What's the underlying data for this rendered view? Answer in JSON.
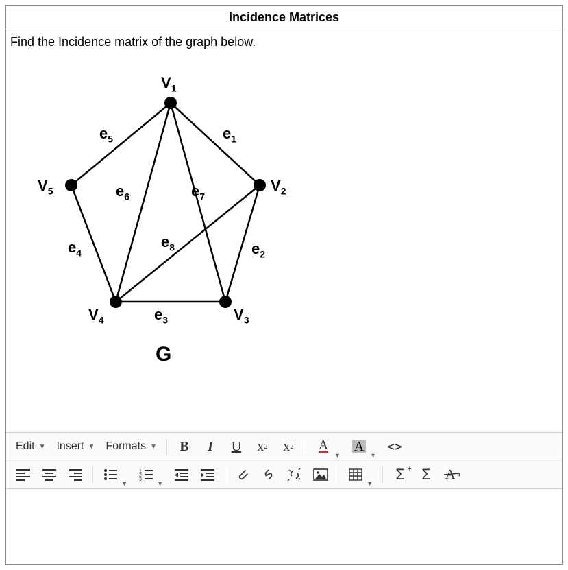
{
  "title": "Incidence Matrices",
  "prompt": "Find the Incidence matrix of the graph below.",
  "graph": {
    "name": "G",
    "vertices": [
      "V1",
      "V2",
      "V3",
      "V4",
      "V5"
    ],
    "edges": {
      "e1": [
        "V1",
        "V2"
      ],
      "e2": [
        "V2",
        "V3"
      ],
      "e3": [
        "V3",
        "V4"
      ],
      "e4": [
        "V4",
        "V5"
      ],
      "e5": [
        "V1",
        "V5"
      ],
      "e6": [
        "V1",
        "V4"
      ],
      "e7": [
        "V1",
        "V3"
      ],
      "e8": [
        "V2",
        "V4"
      ]
    },
    "vertex_labels": {
      "v1": "V",
      "v1s": "1",
      "v2": "V",
      "v2s": "2",
      "v3": "V",
      "v3s": "3",
      "v4": "V",
      "v4s": "4",
      "v5": "V",
      "v5s": "5"
    },
    "edge_labels": {
      "e1": "e",
      "e1s": "1",
      "e2": "e",
      "e2s": "2",
      "e3": "e",
      "e3s": "3",
      "e4": "e",
      "e4s": "4",
      "e5": "e",
      "e5s": "5",
      "e6": "e",
      "e6s": "6",
      "e7": "e",
      "e7s": "7",
      "e8": "e",
      "e8s": "8"
    }
  },
  "toolbar": {
    "menus": {
      "edit": "Edit",
      "insert": "Insert",
      "formats": "Formats"
    },
    "buttons": {
      "bold": "B",
      "italic": "I",
      "underline": "U",
      "sub": "x",
      "sub_s": "2",
      "sup": "x",
      "sup_s": "2",
      "textcolor": "A",
      "bgcolor": "A",
      "code": "<>",
      "sigma_plus": "Σ",
      "sigma": "Σ"
    }
  }
}
